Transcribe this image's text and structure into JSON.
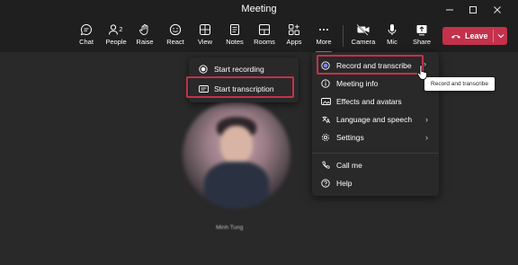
{
  "window": {
    "title": "Meeting"
  },
  "toolbar": {
    "chat": "Chat",
    "people": "People",
    "people_count": "2",
    "raise": "Raise",
    "react": "React",
    "view": "View",
    "notes": "Notes",
    "rooms": "Rooms",
    "apps": "Apps",
    "more": "More",
    "camera": "Camera",
    "mic": "Mic",
    "share": "Share",
    "leave": "Leave"
  },
  "record_submenu": {
    "start_recording": "Start recording",
    "start_transcription": "Start transcription"
  },
  "more_menu": {
    "record_and_transcribe": "Record and transcribe",
    "meeting_info": "Meeting info",
    "effects_and_avatars": "Effects and avatars",
    "language_and_speech": "Language and speech",
    "settings": "Settings",
    "call_me": "Call me",
    "help": "Help"
  },
  "tooltip": "Record and transcribe",
  "participant": {
    "name": "Minh Tung"
  },
  "colors": {
    "accent": "#7f85f5",
    "leave": "#c4314b",
    "highlight": "#c4314b",
    "background": "#1f1f1f"
  }
}
